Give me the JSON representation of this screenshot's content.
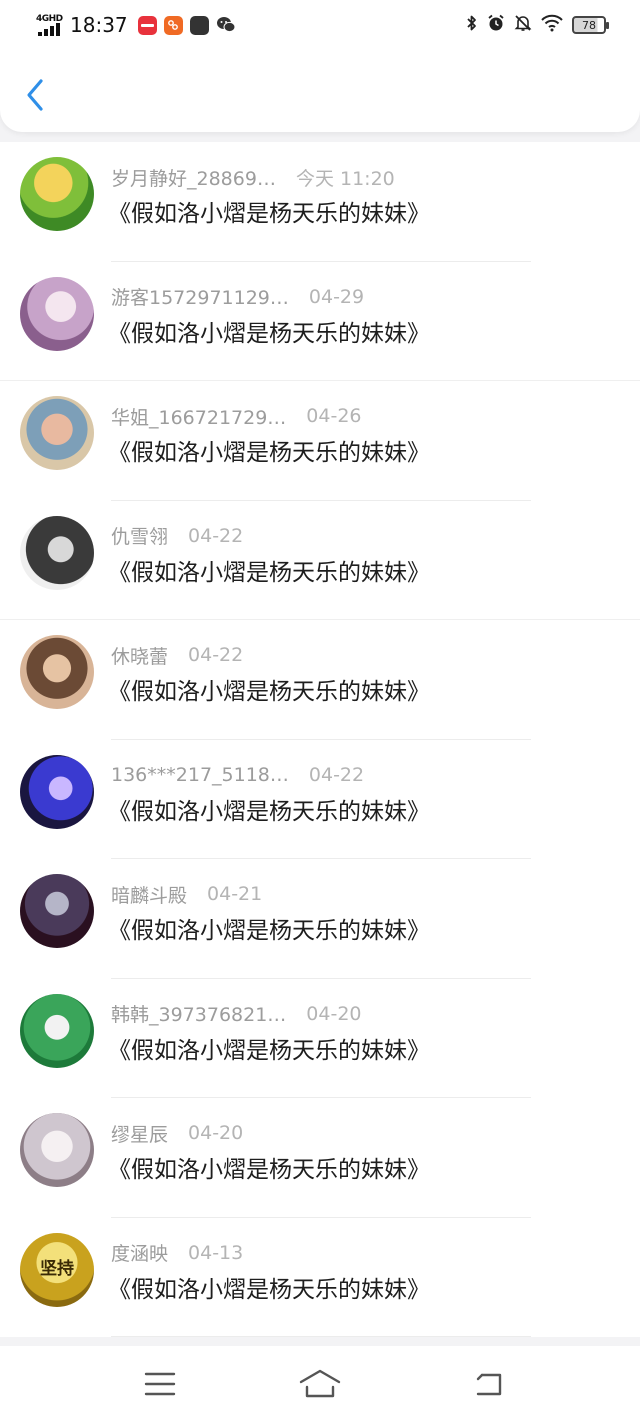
{
  "status_bar": {
    "network": "4GHD",
    "time": "18:37",
    "app_icons": [
      {
        "name": "xiaohongshu-icon",
        "color": "#e8323c",
        "text": "小红书"
      },
      {
        "name": "taobao-icon",
        "color": "#f06a24",
        "text": ""
      },
      {
        "name": "app-icon",
        "color": "#333333",
        "text": ""
      },
      {
        "name": "wechat-icon",
        "color": "#333333",
        "text": ""
      }
    ],
    "battery": "78"
  },
  "header": {
    "back_icon": "chevron-left-icon",
    "accent": "#2f8fe8"
  },
  "items": [
    {
      "name": "岁月静好_28869…",
      "time": "今天 11:20",
      "title": "《假如洛小熠是杨天乐的妹妹》",
      "avatar_bg": "radial-gradient(circle at 45% 35%, #f3d35b 0 30%, #7fbf3a 31% 55%, #3e8a25 56%)"
    },
    {
      "name": "游客1572971129…",
      "time": "04-29",
      "title": "《假如洛小熠是杨天乐的妹妹》",
      "avatar_bg": "radial-gradient(circle at 55% 40%, #f4e6ef 0 25%, #c7a3c9 26% 55%, #8a5f8d 56%)"
    },
    {
      "name": "华姐_166721729…",
      "time": "04-26",
      "title": "《假如洛小熠是杨天乐的妹妹》",
      "avatar_bg": "radial-gradient(circle at 50% 45%, #e8b9a0 0 28%, #7d9fb8 29% 55%, #d9c7a8 56%)"
    },
    {
      "name": "仇雪翎",
      "time": "04-22",
      "title": "《假如洛小熠是杨天乐的妹妹》",
      "avatar_bg": "radial-gradient(circle at 55% 45%, #d8d8d8 0 22%, #3a3a3a 23% 60%, #efefef 61%)"
    },
    {
      "name": "休晓蕾",
      "time": "04-22",
      "title": "《假如洛小熠是杨天乐的妹妹》",
      "avatar_bg": "radial-gradient(circle at 50% 45%, #e6c3a3 0 25%, #6b4a35 26% 55%, #d8b497 56%)"
    },
    {
      "name": "136***217_5118…",
      "time": "04-22",
      "title": "《假如洛小熠是杨天乐的妹妹》",
      "avatar_bg": "radial-gradient(circle at 55% 45%, #c9b7ff 0 20%, #3a3ad0 21% 55%, #1a1640 56%)"
    },
    {
      "name": "暗麟斗殿",
      "time": "04-21",
      "title": "《假如洛小熠是杨天乐的妹妹》",
      "avatar_bg": "radial-gradient(circle at 50% 40%, #b5b5c8 0 20%, #4a3a5a 21% 55%, #2a1020 56%)"
    },
    {
      "name": "韩韩_397376821…",
      "time": "04-20",
      "title": "《假如洛小熠是杨天乐的妹妹》",
      "avatar_bg": "radial-gradient(circle at 50% 45%, #f2f2f2 0 22%, #3aa55a 23% 60%, #1d7a3a 61%)"
    },
    {
      "name": "缪星辰",
      "time": "04-20",
      "title": "《假如洛小熠是杨天乐的妹妹》",
      "avatar_bg": "radial-gradient(circle at 50% 45%, #f5f0f2 0 28%, #cfc6cf 29% 60%, #8d7e87 61%)"
    },
    {
      "name": "度涵映",
      "time": "04-13",
      "title": "《假如洛小熠是杨天乐的妹妹》",
      "avatar_bg": "radial-gradient(circle at 50% 40%, #f3e07a 0 35%, #c9a21e 36% 65%, #8a6a10 66%)",
      "avatar_text": "坚持"
    }
  ],
  "nav": {
    "menu_icon": "menu-icon",
    "home_icon": "home-icon",
    "back_icon": "back-icon"
  }
}
